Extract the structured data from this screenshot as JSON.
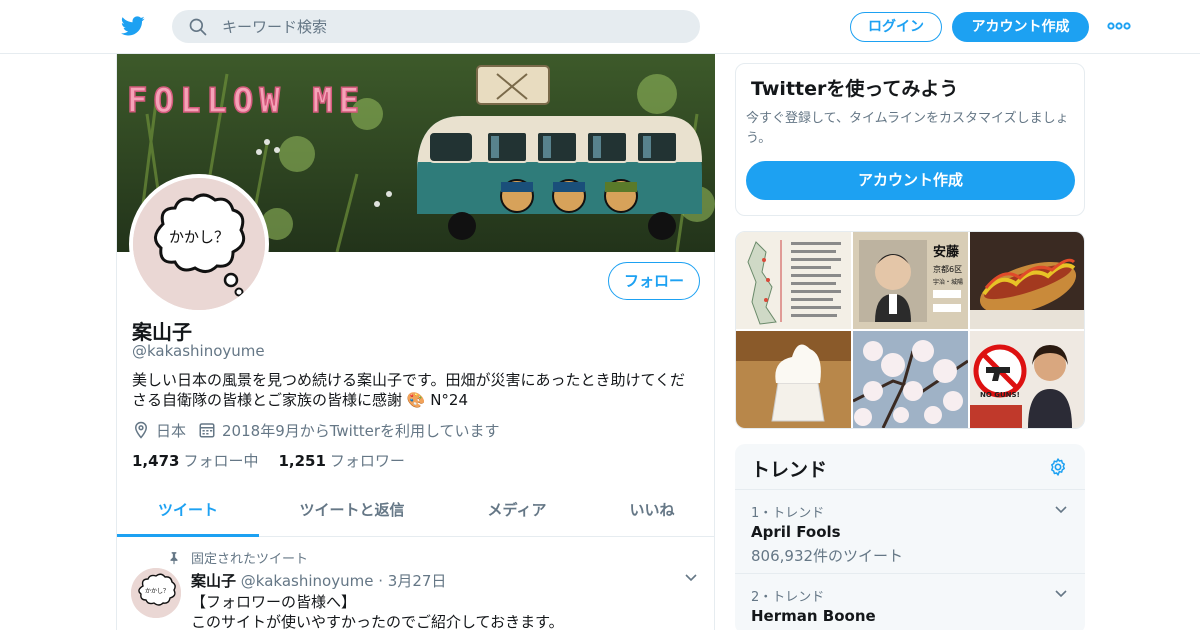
{
  "header": {
    "search_placeholder": "キーワード検索",
    "login_label": "ログイン",
    "signup_label": "アカウント作成"
  },
  "profile": {
    "banner_text": "FOLLOW ME",
    "avatar_text": "かかし？",
    "follow_label": "フォロー",
    "name": "案山子",
    "handle": "@kakashinoyume",
    "bio": "美しい日本の風景を見つめ続ける案山子です。田畑が災害にあったとき助けてくださる自衛隊の皆様とご家族の皆様に感謝 🎨 N°24",
    "location": "日本",
    "joined": "2018年9月からTwitterを利用しています",
    "following_count": "1,473",
    "following_label": "フォロー中",
    "followers_count": "1,251",
    "followers_label": "フォロワー"
  },
  "tabs": [
    {
      "label": "ツイート",
      "active": true
    },
    {
      "label": "ツイートと返信",
      "active": false
    },
    {
      "label": "メディア",
      "active": false
    },
    {
      "label": "いいね",
      "active": false
    }
  ],
  "pinned_tweet": {
    "pinned_label": "固定されたツイート",
    "avatar_text": "かかし？",
    "name": "案山子",
    "handle": "@kakashinoyume",
    "sep": "·",
    "date": "3月27日",
    "line1": "【フォロワーの皆様へ】",
    "line2": "このサイトが使いやすかったのでご紹介しておきます。"
  },
  "signup_card": {
    "title": "Twitterを使ってみよう",
    "text": "今すぐ登録して、タイムラインをカスタマイズしましょう。",
    "button_label": "アカウント作成"
  },
  "media_grid": {
    "poster_top": "安藤",
    "poster_sub": "京都6区",
    "poster_line": "宇治・城陽",
    "no_guns": "NO GUNS!"
  },
  "trends": {
    "title": "トレンド",
    "items": [
      {
        "meta": "1・トレンド",
        "name": "April Fools",
        "count": "806,932件のツイート"
      },
      {
        "meta": "2・トレンド",
        "name": "Herman Boone",
        "count": ""
      }
    ]
  },
  "colors": {
    "accent": "#1da1f2",
    "text": "#14171a",
    "secondary": "#657786",
    "border": "#e6ecf0"
  }
}
